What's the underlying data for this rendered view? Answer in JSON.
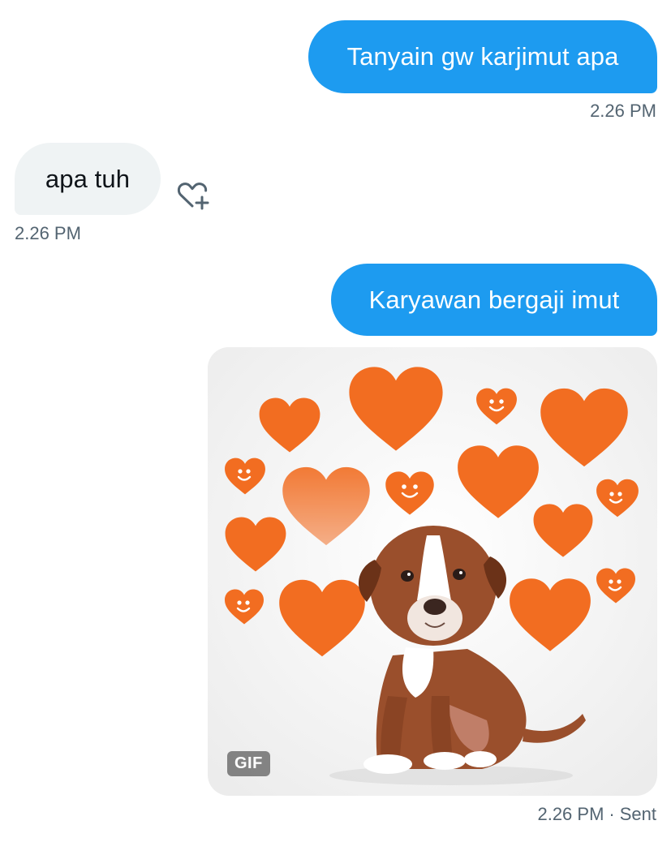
{
  "messages": [
    {
      "text": "Tanyain gw karjimut apa",
      "time": "2.26 PM"
    },
    {
      "text": "apa tuh",
      "time": "2.26 PM"
    },
    {
      "text": "Karyawan bergaji imut"
    },
    {
      "gif_label": "GIF",
      "time": "2.26 PM",
      "status": "Sent",
      "separator": "·"
    }
  ],
  "icons": {
    "react": "heart-plus-icon"
  },
  "colors": {
    "sent_bubble": "#1d9bf0",
    "received_bubble": "#eff3f4",
    "timestamp": "#536471",
    "heart": "#f26d21",
    "puppy_brown": "#9a4f2c"
  }
}
